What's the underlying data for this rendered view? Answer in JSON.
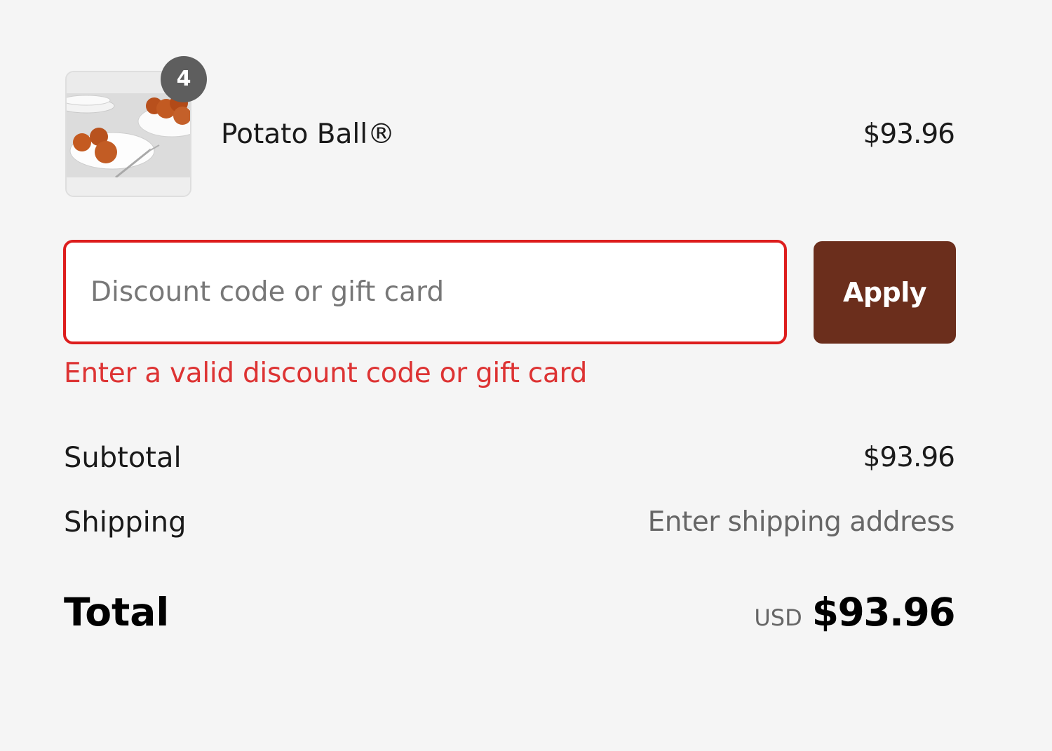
{
  "cart": {
    "items": [
      {
        "name": "Potato Ball®",
        "price": "$93.96",
        "quantity": "4",
        "thumbnail_icon": "potato-ball-plate-image"
      }
    ]
  },
  "discount": {
    "placeholder": "Discount code or gift card",
    "value": "",
    "apply_label": "Apply",
    "error": "Enter a valid discount code or gift card"
  },
  "summary": {
    "subtotal_label": "Subtotal",
    "subtotal_value": "$93.96",
    "shipping_label": "Shipping",
    "shipping_value": "Enter shipping address",
    "total_label": "Total",
    "currency": "USD",
    "total_value": "$93.96"
  },
  "colors": {
    "background": "#f5f5f5",
    "accent_button": "#6b2e1c",
    "error": "#dd1d1d",
    "badge": "#5e5e5e"
  }
}
